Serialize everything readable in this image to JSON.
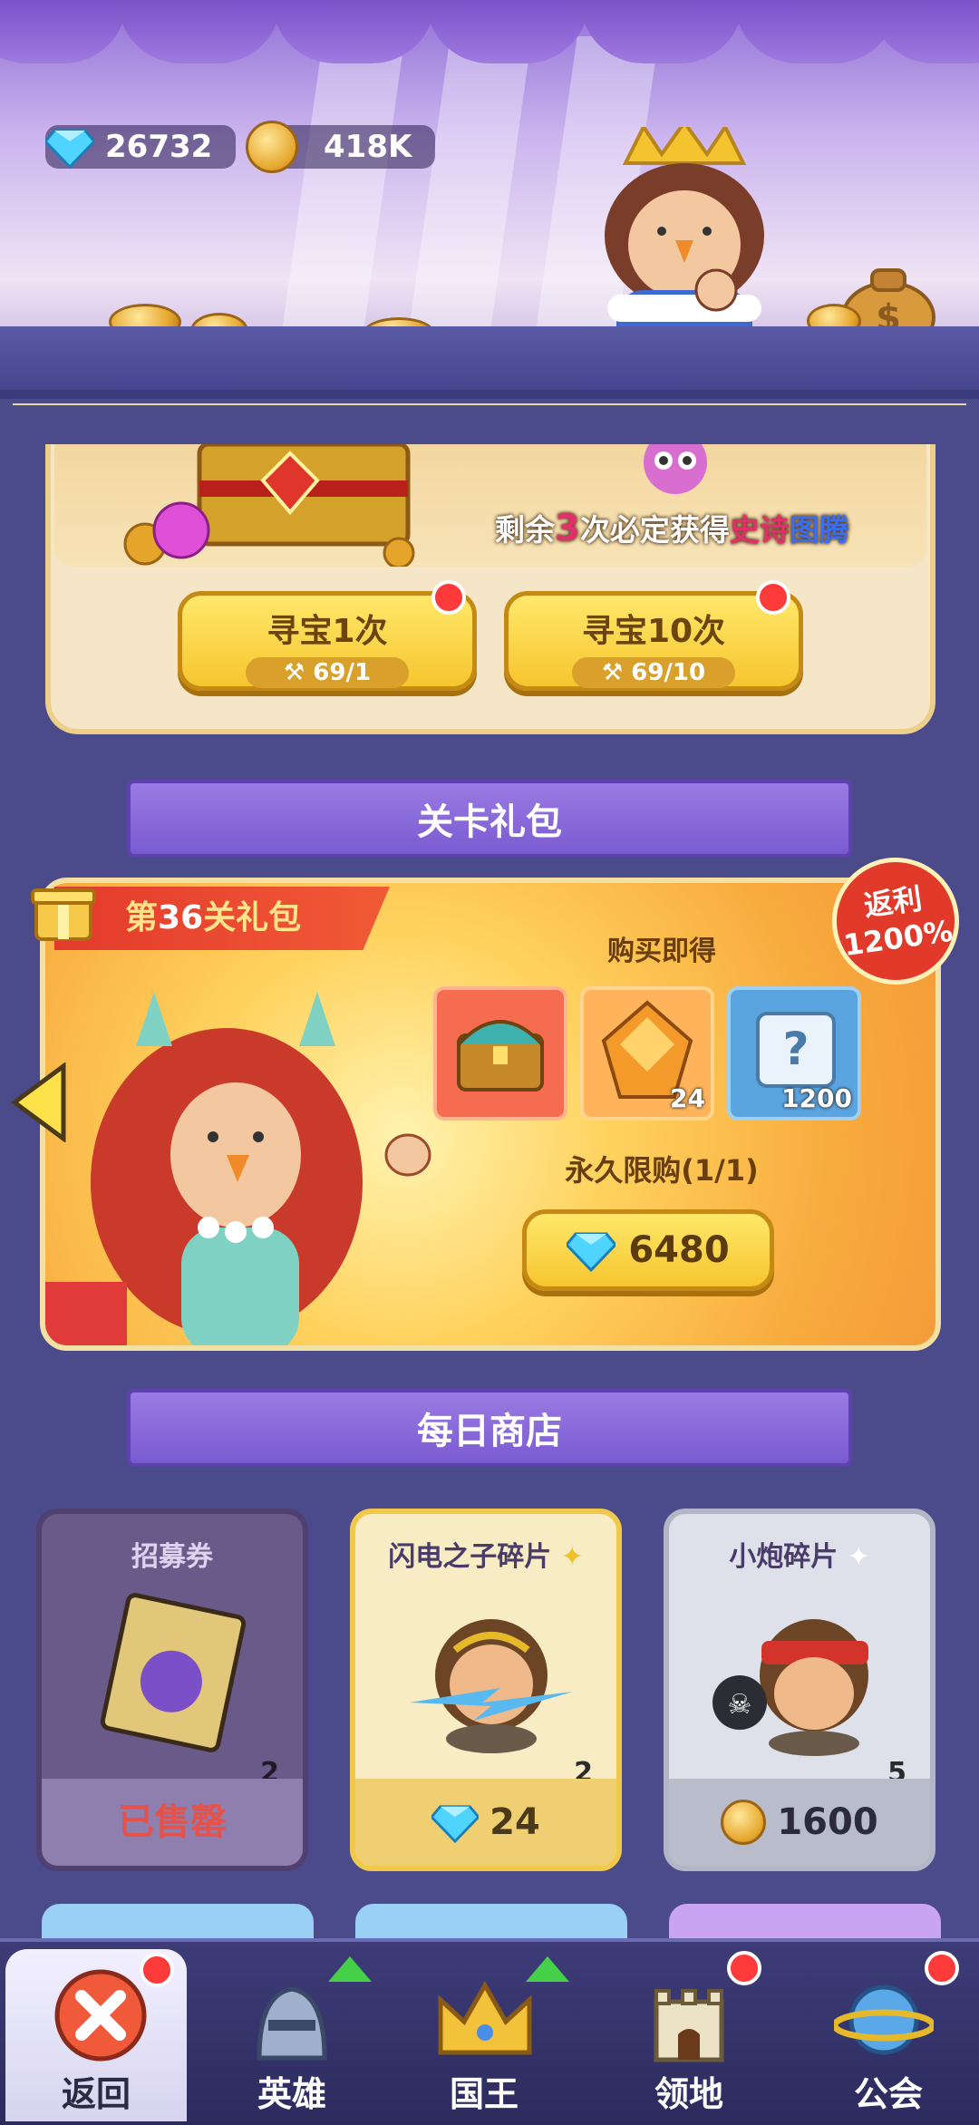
{
  "currency": {
    "gems": "26732",
    "gold": "418K"
  },
  "treasure": {
    "notice_prefix": "剩余",
    "notice_count": "3",
    "notice_mid": "次必定获得",
    "notice_highlight": "史诗图腾",
    "buttons": [
      {
        "label": "寻宝1次",
        "cost": "69/1"
      },
      {
        "label": "寻宝10次",
        "cost": "69/10"
      }
    ]
  },
  "stage_pack": {
    "section_title": "关卡礼包",
    "label_prefix": "第",
    "label_num": "36",
    "label_suffix": "关礼包",
    "rebate_line1": "返利",
    "rebate_line2": "1200%",
    "buy_hint": "购买即得",
    "items": [
      {
        "name": "treasure-chest",
        "count": ""
      },
      {
        "name": "orange-crystal",
        "count": "24"
      },
      {
        "name": "mystery-scroll",
        "count": "1200"
      }
    ],
    "limit": "永久限购(1/1)",
    "price": "6480"
  },
  "daily_shop": {
    "section_title": "每日商店",
    "cards": [
      {
        "title": "招募券",
        "qty": "2",
        "footer": "已售罄"
      },
      {
        "title": "闪电之子碎片",
        "qty": "2",
        "price": "24"
      },
      {
        "title": "小炮碎片",
        "qty": "5",
        "price": "1600"
      }
    ]
  },
  "nav": [
    {
      "label": "返回"
    },
    {
      "label": "英雄"
    },
    {
      "label": "国王"
    },
    {
      "label": "领地"
    },
    {
      "label": "公会"
    }
  ],
  "colors": {
    "accent_purple": "#7a5ad1",
    "gem_blue": "#38c6f4",
    "alert_red": "#ff3a3a",
    "highlight_pink": "#e0306a",
    "highlight_blue": "#3a6ef0"
  }
}
